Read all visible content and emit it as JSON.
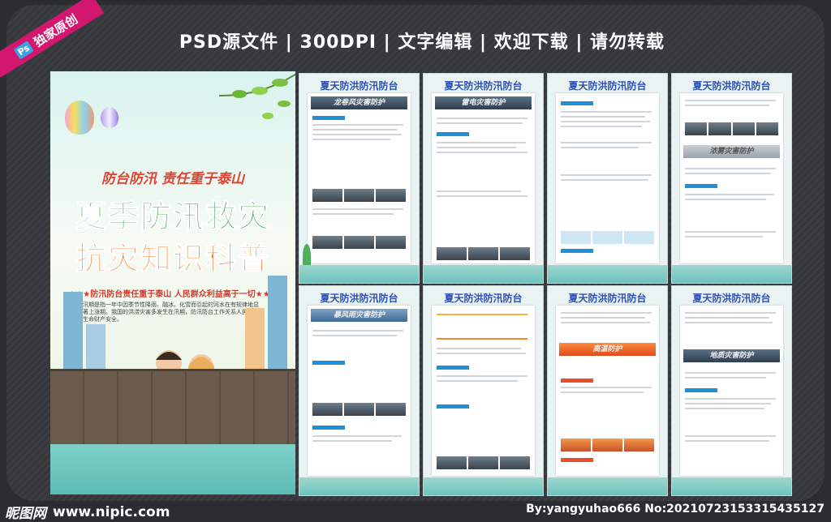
{
  "header": {
    "text": "PSD源文件 | 300DPI | 文字编辑 | 欢迎下载 | 请勿转载"
  },
  "ribbon": {
    "ps": "Ps",
    "text": "独家原创"
  },
  "poster": {
    "slogan_top": "防台防汛 责任重于泰山",
    "title_line1": "夏季防汛救灾",
    "title_line2": "抗灾知识科普",
    "slogan_bottom": "★★★防汛防台责任重于泰山 人民群众利益高于一切★★★",
    "intro": "汛期是指一年中因季节性降雨、融冰、化雪而引起的河水在有规律地显著上涨期。我国的洪涝灾害多发生在汛期，防汛防台工作关系人民群众生命财产安全。"
  },
  "panels": [
    {
      "title": "夏天防洪防汛防台",
      "banner": "龙卷风灾害防护"
    },
    {
      "title": "夏天防洪防汛防台",
      "banner": "雷电灾害防护"
    },
    {
      "title": "夏天防洪防汛防台",
      "banner": ""
    },
    {
      "title": "夏天防洪防汛防台",
      "banner": "浓雾灾害防护"
    },
    {
      "title": "夏天防洪防汛防台",
      "banner": "暴风雨灾害防护"
    },
    {
      "title": "夏天防洪防汛防台",
      "banner": ""
    },
    {
      "title": "夏天防洪防汛防台",
      "banner": "高温防护"
    },
    {
      "title": "夏天防洪防汛防台",
      "banner": "地质灾害防护"
    }
  ],
  "footer": {
    "site_logo": "昵图网",
    "site_url": "www.nipic.com",
    "author": "By:yangyuhao666 No:20210723153315435127"
  }
}
